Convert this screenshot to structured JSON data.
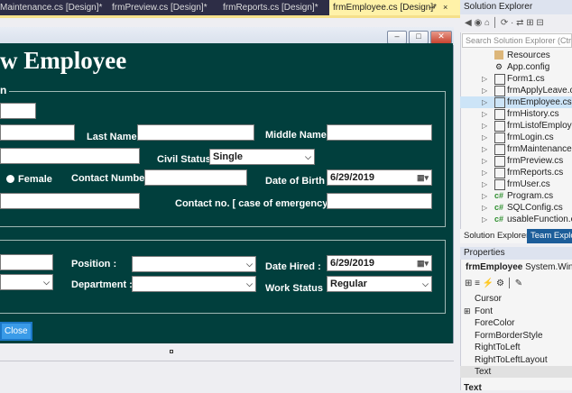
{
  "tabs": [
    {
      "label": "Maintenance.cs [Design]*"
    },
    {
      "label": "frmPreview.cs [Design]*"
    },
    {
      "label": "frmReports.cs [Design]*"
    },
    {
      "label": "frmEmployee.cs [Design]*",
      "active": true
    }
  ],
  "tab_icons": {
    "pin": "pin-icon",
    "close": "×"
  },
  "form": {
    "title": "w Employee",
    "group1_title": "n",
    "last_name_label": "Last Name",
    "middle_name_label": "Middle Name",
    "civil_status_label": "Civil Status",
    "civil_status_value": "Single",
    "female_label": "Female",
    "contact_number_label": "Contact Number",
    "date_of_birth_label": "Date of Birth",
    "date_of_birth_value": "6/29/2019",
    "emergency_label": "Contact no. [ case of emergency ]",
    "position_label": "Position :",
    "department_label": "Department :",
    "date_hired_label": "Date Hired :",
    "date_hired_value": "6/29/2019",
    "work_status_label": "Work Status :",
    "work_status_value": "Regular",
    "close_label": "Close",
    "window_buttons": [
      "–",
      "□",
      "✕"
    ]
  },
  "solution_explorer": {
    "title": "Solution Explorer",
    "toolbar": "◀ ◉ ⌂ │ ⟳ · ⇄ ⊞ ⊟",
    "search_placeholder": "Search Solution Explorer (Ctrl+;)",
    "items": [
      {
        "label": "Resources",
        "icon": "folder-icon",
        "expandable": false
      },
      {
        "label": "App.config",
        "icon": "config-icon",
        "expandable": false
      },
      {
        "label": "Form1.cs",
        "icon": "form-icon",
        "expandable": true
      },
      {
        "label": "frmApplyLeave.cs",
        "icon": "form-icon",
        "expandable": true
      },
      {
        "label": "frmEmployee.cs",
        "icon": "form-icon",
        "expandable": true,
        "selected": true
      },
      {
        "label": "frmHistory.cs",
        "icon": "form-icon",
        "expandable": true
      },
      {
        "label": "frmListofEmployee",
        "icon": "form-icon",
        "expandable": true
      },
      {
        "label": "frmLogin.cs",
        "icon": "form-icon",
        "expandable": true
      },
      {
        "label": "frmMaintenance.cs",
        "icon": "form-icon",
        "expandable": true
      },
      {
        "label": "frmPreview.cs",
        "icon": "form-icon",
        "expandable": true
      },
      {
        "label": "frmReports.cs",
        "icon": "form-icon",
        "expandable": true
      },
      {
        "label": "frmUser.cs",
        "icon": "form-icon",
        "expandable": true
      },
      {
        "label": "Program.cs",
        "icon": "csharp-icon",
        "expandable": true
      },
      {
        "label": "SQLConfig.cs",
        "icon": "csharp-icon",
        "expandable": true
      },
      {
        "label": "usableFunction.cs",
        "icon": "csharp-icon",
        "expandable": true
      }
    ],
    "bottom_tabs": [
      "Solution Explorer",
      "Team Explorer"
    ]
  },
  "properties": {
    "title": "Properties",
    "object_name": "frmEmployee",
    "object_type": "System.Windows.Forms.Form",
    "toolbar": "⊞ ≡ ⚡ ⚙ │ ✎",
    "rows": [
      {
        "name": "Cursor"
      },
      {
        "name": "Font",
        "expandable": true
      },
      {
        "name": "ForeColor"
      },
      {
        "name": "FormBorderStyle"
      },
      {
        "name": "RightToLeft"
      },
      {
        "name": "RightToLeftLayout"
      },
      {
        "name": "Text",
        "selected": true
      }
    ],
    "description_title": "Text"
  },
  "colors": {
    "form_background": "#013f3d",
    "active_tab": "#fff2a8",
    "tab_bar": "#2d2d46",
    "close_button": "#3a9be8",
    "selection": "#cce4f7"
  }
}
